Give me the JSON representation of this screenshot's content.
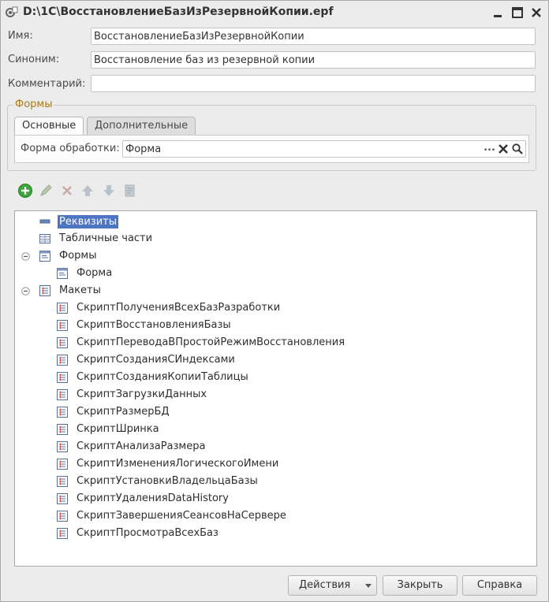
{
  "window": {
    "title": "D:\\1C\\ВосстановлениеБазИзРезервнойКопии.epf"
  },
  "fields": {
    "name_label": "Имя:",
    "name_value": "ВосстановлениеБазИзРезервнойКопии",
    "synonym_label": "Синоним:",
    "synonym_value": "Восстановление баз из резервной копии",
    "comment_label": "Комментарий:",
    "comment_value": ""
  },
  "forms_group": {
    "title": "Формы",
    "tabs": [
      {
        "label": "Основные",
        "active": true
      },
      {
        "label": "Дополнительные",
        "active": false
      }
    ],
    "processing_form_label": "Форма обработки:",
    "processing_form_value": "Форма",
    "choose_button": "...",
    "clear_icon": "clear-x-icon",
    "open_icon": "magnifier-icon"
  },
  "toolbar": {
    "icons": [
      "add-icon",
      "edit-icon",
      "delete-icon",
      "move-up-icon",
      "move-down-icon",
      "properties-icon"
    ]
  },
  "tree": {
    "items": [
      {
        "label": "Реквизиты",
        "level": 1,
        "icon": "attributes-icon",
        "expander": "none",
        "selected": true
      },
      {
        "label": "Табличные части",
        "level": 1,
        "icon": "tabular-sections-icon",
        "expander": "none"
      },
      {
        "label": "Формы",
        "level": 1,
        "icon": "forms-icon",
        "expander": "expanded"
      },
      {
        "label": "Форма",
        "level": 2,
        "icon": "form-icon",
        "expander": "none"
      },
      {
        "label": "Макеты",
        "level": 1,
        "icon": "templates-icon",
        "expander": "expanded"
      },
      {
        "label": "СкриптПолученияВсехБазРазработки",
        "level": 2,
        "icon": "template-icon"
      },
      {
        "label": "СкриптВосстановленияБазы",
        "level": 2,
        "icon": "template-icon"
      },
      {
        "label": "СкриптПереводаВПростойРежимВосстановления",
        "level": 2,
        "icon": "template-icon"
      },
      {
        "label": "СкриптСозданияСИндексами",
        "level": 2,
        "icon": "template-icon"
      },
      {
        "label": "СкриптСозданияКопииТаблицы",
        "level": 2,
        "icon": "template-icon"
      },
      {
        "label": "СкриптЗагрузкиДанных",
        "level": 2,
        "icon": "template-icon"
      },
      {
        "label": "СкриптРазмерБД",
        "level": 2,
        "icon": "template-icon"
      },
      {
        "label": "СкриптШринка",
        "level": 2,
        "icon": "template-icon"
      },
      {
        "label": "СкриптАнализаРазмера",
        "level": 2,
        "icon": "template-icon"
      },
      {
        "label": "СкриптИзмененияЛогическогоИмени",
        "level": 2,
        "icon": "template-icon"
      },
      {
        "label": "СкриптУстановкиВладельцаБазы",
        "level": 2,
        "icon": "template-icon"
      },
      {
        "label": "СкриптУдаленияDataHistory",
        "level": 2,
        "icon": "template-icon"
      },
      {
        "label": "СкриптЗавершенияСеансовНаСервере",
        "level": 2,
        "icon": "template-icon"
      },
      {
        "label": "СкриптПросмотраВсехБаз",
        "level": 2,
        "icon": "template-icon"
      }
    ]
  },
  "buttons": {
    "actions": "Действия",
    "close": "Закрыть",
    "help": "Справка"
  },
  "colors": {
    "selection": "#4e74c4",
    "group_title": "#a87a1c",
    "add_green": "#3aa63a"
  }
}
